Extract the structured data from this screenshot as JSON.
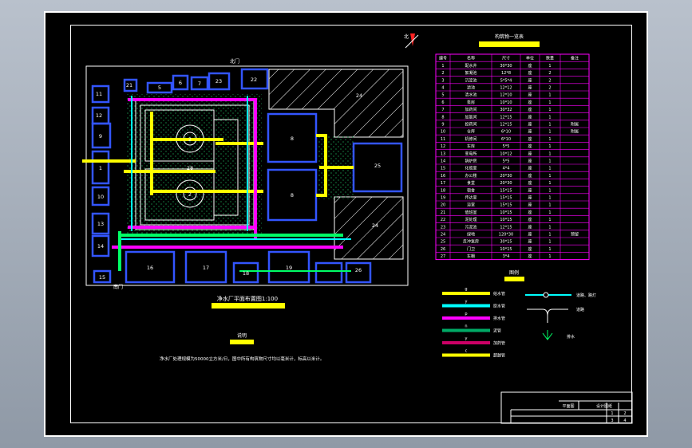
{
  "drawing": {
    "title": "净水厂平面布置图1:100",
    "notes_heading": "说明",
    "note_text": "净水厂处理规模为50000立方米/日，图中所有构筑物尺寸均以毫米计，标高以米计。",
    "north_label": "北",
    "gate_north": "北门",
    "gate_south": "南门",
    "table_title": "构筑物一览表",
    "legend_title": "图例",
    "title_block_label": "平面图",
    "title_block_name": "设计图纸",
    "title_block_cells": [
      "1",
      "2",
      "3",
      "4"
    ]
  },
  "plan_labels": [
    "11",
    "12",
    "21",
    "5",
    "6",
    "7",
    "23",
    "22",
    "9",
    "1",
    "10",
    "13",
    "14",
    "15",
    "16",
    "17",
    "18",
    "19",
    "26",
    "2",
    "2",
    "28",
    "8",
    "8",
    "24",
    "24",
    "25"
  ],
  "table": {
    "headers": [
      "编号",
      "名称",
      "尺寸",
      "单位",
      "数量",
      "备注"
    ],
    "rows": [
      [
        "1",
        "配水井",
        "30*30",
        "座",
        "1",
        ""
      ],
      [
        "2",
        "絮凝池",
        "12*8",
        "座",
        "2",
        ""
      ],
      [
        "3",
        "沉淀池",
        "5*5*4",
        "座",
        "2",
        ""
      ],
      [
        "4",
        "滤池",
        "12*12",
        "座",
        "2",
        ""
      ],
      [
        "5",
        "清水池",
        "12*10",
        "座",
        "1",
        ""
      ],
      [
        "6",
        "泵房",
        "10*10",
        "座",
        "1",
        ""
      ],
      [
        "7",
        "加药间",
        "30*32",
        "座",
        "1",
        ""
      ],
      [
        "8",
        "加氯间",
        "12*15",
        "座",
        "1",
        ""
      ],
      [
        "9",
        "投药间",
        "12*15",
        "座",
        "1",
        "附属"
      ],
      [
        "10",
        "仓库",
        "6*10",
        "座",
        "1",
        "附属"
      ],
      [
        "11",
        "机修间",
        "6*10",
        "座",
        "1",
        ""
      ],
      [
        "12",
        "车库",
        "5*5",
        "座",
        "1",
        ""
      ],
      [
        "13",
        "变电所",
        "10*12",
        "座",
        "1",
        ""
      ],
      [
        "14",
        "锅炉房",
        "5*5",
        "座",
        "1",
        ""
      ],
      [
        "15",
        "化验室",
        "4*4",
        "座",
        "1",
        ""
      ],
      [
        "16",
        "办公楼",
        "20*30",
        "座",
        "1",
        ""
      ],
      [
        "17",
        "食堂",
        "20*30",
        "座",
        "1",
        ""
      ],
      [
        "18",
        "宿舍",
        "15*15",
        "座",
        "1",
        ""
      ],
      [
        "19",
        "传达室",
        "15*15",
        "座",
        "1",
        ""
      ],
      [
        "20",
        "浴室",
        "15*15",
        "座",
        "1",
        ""
      ],
      [
        "21",
        "值班室",
        "10*15",
        "座",
        "1",
        ""
      ],
      [
        "22",
        "泥处理",
        "10*15",
        "座",
        "1",
        ""
      ],
      [
        "23",
        "污泥池",
        "12*15",
        "座",
        "1",
        ""
      ],
      [
        "24",
        "绿地",
        "120*30",
        "座",
        "1",
        "预留"
      ],
      [
        "25",
        "反冲泵房",
        "30*15",
        "座",
        "1",
        ""
      ],
      [
        "26",
        "门卫",
        "10*15",
        "座",
        "1",
        ""
      ],
      [
        "27",
        "车棚",
        "3*4",
        "座",
        "1",
        ""
      ]
    ]
  },
  "legend": [
    {
      "code": "g",
      "desc": "给水管",
      "color": "#ffff00"
    },
    {
      "code": "y",
      "desc": "原水管",
      "color": "#00ffff"
    },
    {
      "code": "p",
      "desc": "排水管",
      "color": "#ff00ff"
    },
    {
      "code": "n",
      "desc": "泥管",
      "color": "#00aa66"
    },
    {
      "code": "y",
      "desc": "加药管",
      "color": "#cc0066"
    },
    {
      "code": "c",
      "desc": "超越管",
      "color": "#ffff00"
    }
  ],
  "legend_right": [
    {
      "desc": "道路、路灯"
    },
    {
      "desc": "道路"
    },
    {
      "desc": "排水"
    }
  ]
}
